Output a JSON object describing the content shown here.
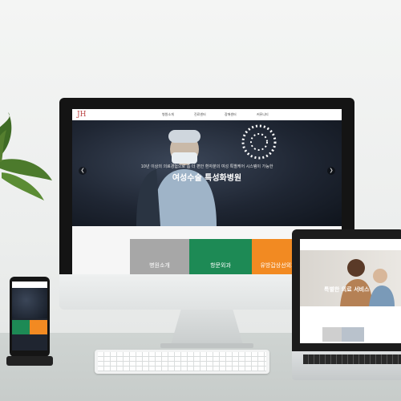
{
  "desktop_site": {
    "logo": "JH",
    "nav": [
      "병원소개",
      "진료센터",
      "장애센터",
      "커뮤니티"
    ],
    "hero": {
      "subtitle": "10년 이상의 의료경험으로 좀 더 편안 환자분의 여성 특별케어 시스템이 가능한",
      "title": "여성수술 특성화병원",
      "prev_icon": "chevron-left-icon",
      "next_icon": "chevron-right-icon"
    },
    "tiles": [
      {
        "label": "병원소개",
        "color": "#a7a7a7"
      },
      {
        "label": "항문외과",
        "color": "#1d8a55"
      },
      {
        "label": "유방갑상선외과",
        "color": "#f28a22"
      }
    ]
  },
  "laptop_site": {
    "hero_text": "특별한 의료 서비스"
  },
  "colors": {
    "accent_green": "#1d8a55",
    "accent_orange": "#f28a22"
  }
}
